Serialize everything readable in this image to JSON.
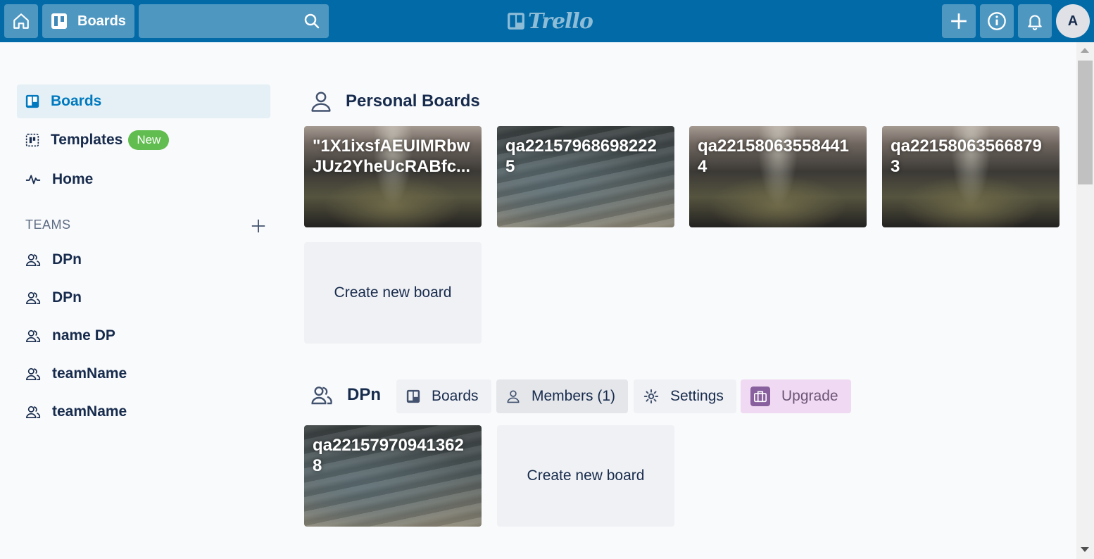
{
  "header": {
    "boards_label": "Boards",
    "search_value": "",
    "logo_text": "Trello",
    "avatar_initial": "A"
  },
  "sidebar": {
    "items": [
      {
        "label": "Boards",
        "icon": "board-icon",
        "active": true
      },
      {
        "label": "Templates",
        "icon": "template-icon",
        "badge": "New"
      },
      {
        "label": "Home",
        "icon": "activity-icon"
      }
    ],
    "teams_label": "TEAMS",
    "teams": [
      {
        "label": "DPn"
      },
      {
        "label": "DPn"
      },
      {
        "label": "name DP"
      },
      {
        "label": "teamName"
      },
      {
        "label": "teamName"
      }
    ]
  },
  "personal": {
    "title": "Personal Boards",
    "boards": [
      {
        "title": "\"1X1ixsfAEUIMRbwJUz2YheUcRABfc...",
        "background": "valley"
      },
      {
        "title": "qa221579686982225",
        "background": "water"
      },
      {
        "title": "qa221580635584414",
        "background": "valley"
      },
      {
        "title": "qa221580635668793",
        "background": "valley"
      }
    ],
    "create_label": "Create new board"
  },
  "team_section": {
    "title": "DPn",
    "tabs": {
      "boards": "Boards",
      "members": "Members (1)",
      "settings": "Settings",
      "upgrade": "Upgrade"
    },
    "boards": [
      {
        "title": "qa221579709413628",
        "background": "water"
      }
    ],
    "create_label": "Create new board"
  },
  "colors": {
    "header": "#026aa7",
    "active_item": "#0079bf",
    "badge": "#61bd4f",
    "upgrade": "#89609e"
  }
}
